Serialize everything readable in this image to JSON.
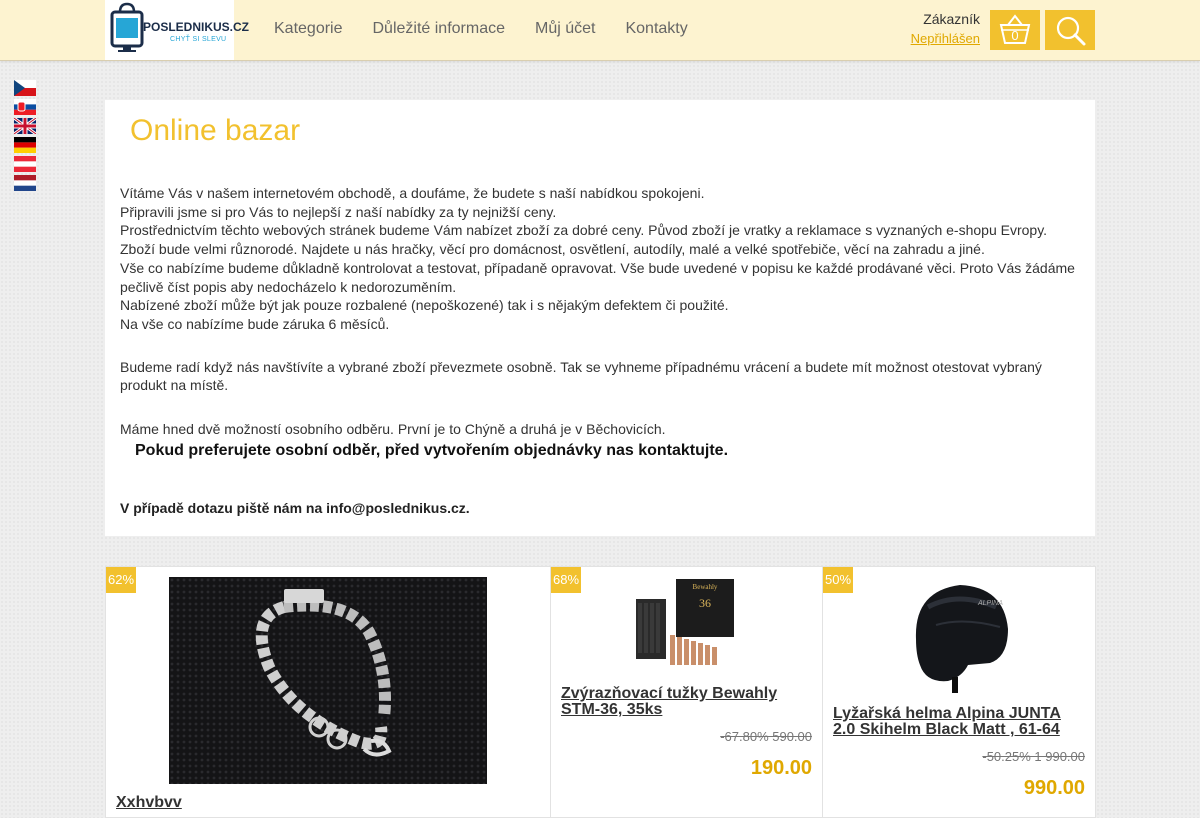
{
  "header": {
    "logo": {
      "name": "POSLEDNIKUS.CZ",
      "slogan": "CHYŤ SI SLEVU"
    },
    "nav": [
      "Kategorie",
      "Důležité informace",
      "Můj účet",
      "Kontakty"
    ],
    "customer": {
      "label": "Zákazník",
      "status": "Nepřihlášen"
    },
    "cart": {
      "count": "0",
      "icon": "basket-icon"
    },
    "search": {
      "icon": "search-icon"
    }
  },
  "languages": [
    "cz",
    "sk",
    "en",
    "de",
    "at",
    "nl"
  ],
  "intro": {
    "title": "Online bazar",
    "paragraphs": [
      "Vítáme Vás v našem internetovém obchodě, a doufáme, že budete s naší nabídkou spokojeni.",
      "Připravili jsme si pro Vás to nejlepší z naší nabídky za ty nejnižší ceny.",
      "Prostřednictvím těchto webových stránek budeme Vám nabízet zboží za dobré ceny. Původ zboží je vratky a reklamace s vyznaných e-shopu Evropy.",
      "Zboží bude velmi různorodé. Najdete u nás hračky, věcí pro domácnost, osvětlení, autodíly, malé a velké spotřebiče, věcí na zahradu a jiné.",
      "Vše co nabízíme budeme důkladně kontrolovat a testovat, případaně opravovat. Vše bude uvedené v popisu ke každé prodávané věci. Proto Vás žádáme pečlivě číst popis aby nedocházelo k nedorozuměním.",
      "Nabízené zboží může být jak pouze rozbalené (nepoškozené) tak i s nějakým defektem či použité.",
      "Na vše co nabízíme bude záruka 6 měsíců."
    ],
    "pickup": "Budeme radí když nás navštívíte a vybrané zboží převezmete osobně. Tak se vyhneme případnému vrácení a budete mít možnost otestovat vybraný produkt na místě.",
    "locations": "Máme hned dvě možností osobního odběru. První je to Chýně a druhá je v Běchovicích.",
    "notice": "Pokud preferujete osobní odběr, před vytvořením objednávky nas kontaktujte.",
    "contact": "V případě dotazu piště nám na info@poslednikus.cz."
  },
  "products": [
    {
      "discount": "62%",
      "title": "Xxhvbvv",
      "old_price": "",
      "price": ""
    },
    {
      "discount": "68%",
      "title": "Zvýrazňovací tužky Bewahly STM-36, 35ks",
      "old_price": "-67.80% 590.00",
      "price": "190.00",
      "box_label": "Bewahly",
      "box_number": "36"
    },
    {
      "discount": "50%",
      "title": "Lyžařská helma Alpina JUNTA 2.0 Skihelm Black Matt , 61-64",
      "old_price": "-50.25% 1 990.00",
      "price": "990.00",
      "helmet_brand": "ALPINA"
    }
  ]
}
